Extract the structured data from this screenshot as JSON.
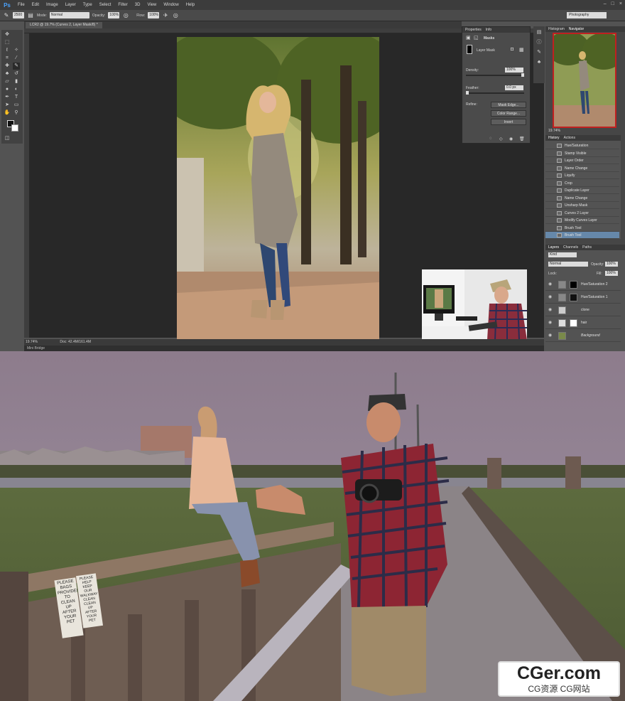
{
  "app": {
    "logo": "Ps",
    "menu": [
      "File",
      "Edit",
      "Image",
      "Layer",
      "Type",
      "Select",
      "Filter",
      "3D",
      "View",
      "Window",
      "Help"
    ],
    "window_controls": [
      "–",
      "□",
      "×"
    ]
  },
  "options_bar": {
    "brush_size": "2500",
    "mode_label": "Mode:",
    "mode_value": "Normal",
    "opacity_label": "Opacity:",
    "opacity_value": "100%",
    "flow_label": "Flow:",
    "flow_value": "100%",
    "workspace": "Photography"
  },
  "document": {
    "tab_title": "LCR2 @ 19.7% (Curves 2, Layer Mask/8) *",
    "zoom": "19.74%",
    "doc_info": "Doc: 42.4M/161.4M",
    "bottom_panel": "Mini Bridge"
  },
  "properties": {
    "tabs": [
      "Properties",
      "Info"
    ],
    "title": "Masks",
    "mask_label": "Layer Mask",
    "density_label": "Density:",
    "density_value": "100%",
    "density_fraction": 1.0,
    "feather_label": "Feather:",
    "feather_value": "0.0 px",
    "feather_fraction": 0.0,
    "refine_label": "Refine:",
    "buttons": [
      "Mask Edge...",
      "Color Range...",
      "Invert"
    ]
  },
  "navigator": {
    "tabs": [
      "Histogram",
      "Navigator"
    ],
    "zoom": "19.74%"
  },
  "history": {
    "tabs": [
      "History",
      "Actions"
    ],
    "items": [
      "Hue/Saturation",
      "Stamp Visible",
      "Layer Order",
      "Name Change",
      "Liquify",
      "Crop",
      "Duplicate Layer",
      "Name Change",
      "Unsharp Mask",
      "Curves 2 Layer",
      "Modify Curves Layer",
      "Brush Tool",
      "Brush Tool"
    ],
    "selected_index": 12
  },
  "layers": {
    "tabs": [
      "Layers",
      "Channels",
      "Paths"
    ],
    "filter": "Kind",
    "blend_mode": "Normal",
    "opacity_label": "Opacity:",
    "opacity_value": "100%",
    "lock_label": "Lock:",
    "fill_label": "Fill:",
    "fill_value": "100%",
    "rows": [
      {
        "name": "Hue/Saturation 2"
      },
      {
        "name": "Hue/Saturation 1"
      },
      {
        "name": "clone"
      },
      {
        "name": "hair"
      },
      {
        "name": "Background"
      }
    ]
  },
  "watermark": {
    "main": "CGer.com",
    "sub": "CG资源 CG网站"
  },
  "sign": {
    "left_text": "PLEASE BAGS PROVIDED TO CLEAN UP AFTER YOUR PET",
    "right_text": "PLEASE HELP KEEP OUR WALKWAY CLEAN CLEAN UP AFTER YOUR PET"
  },
  "colors": {
    "ps_bg": "#535353",
    "history_selected": "#6688aa",
    "navigator_frame": "#c02020",
    "video_sky": "#8c7e8c"
  }
}
